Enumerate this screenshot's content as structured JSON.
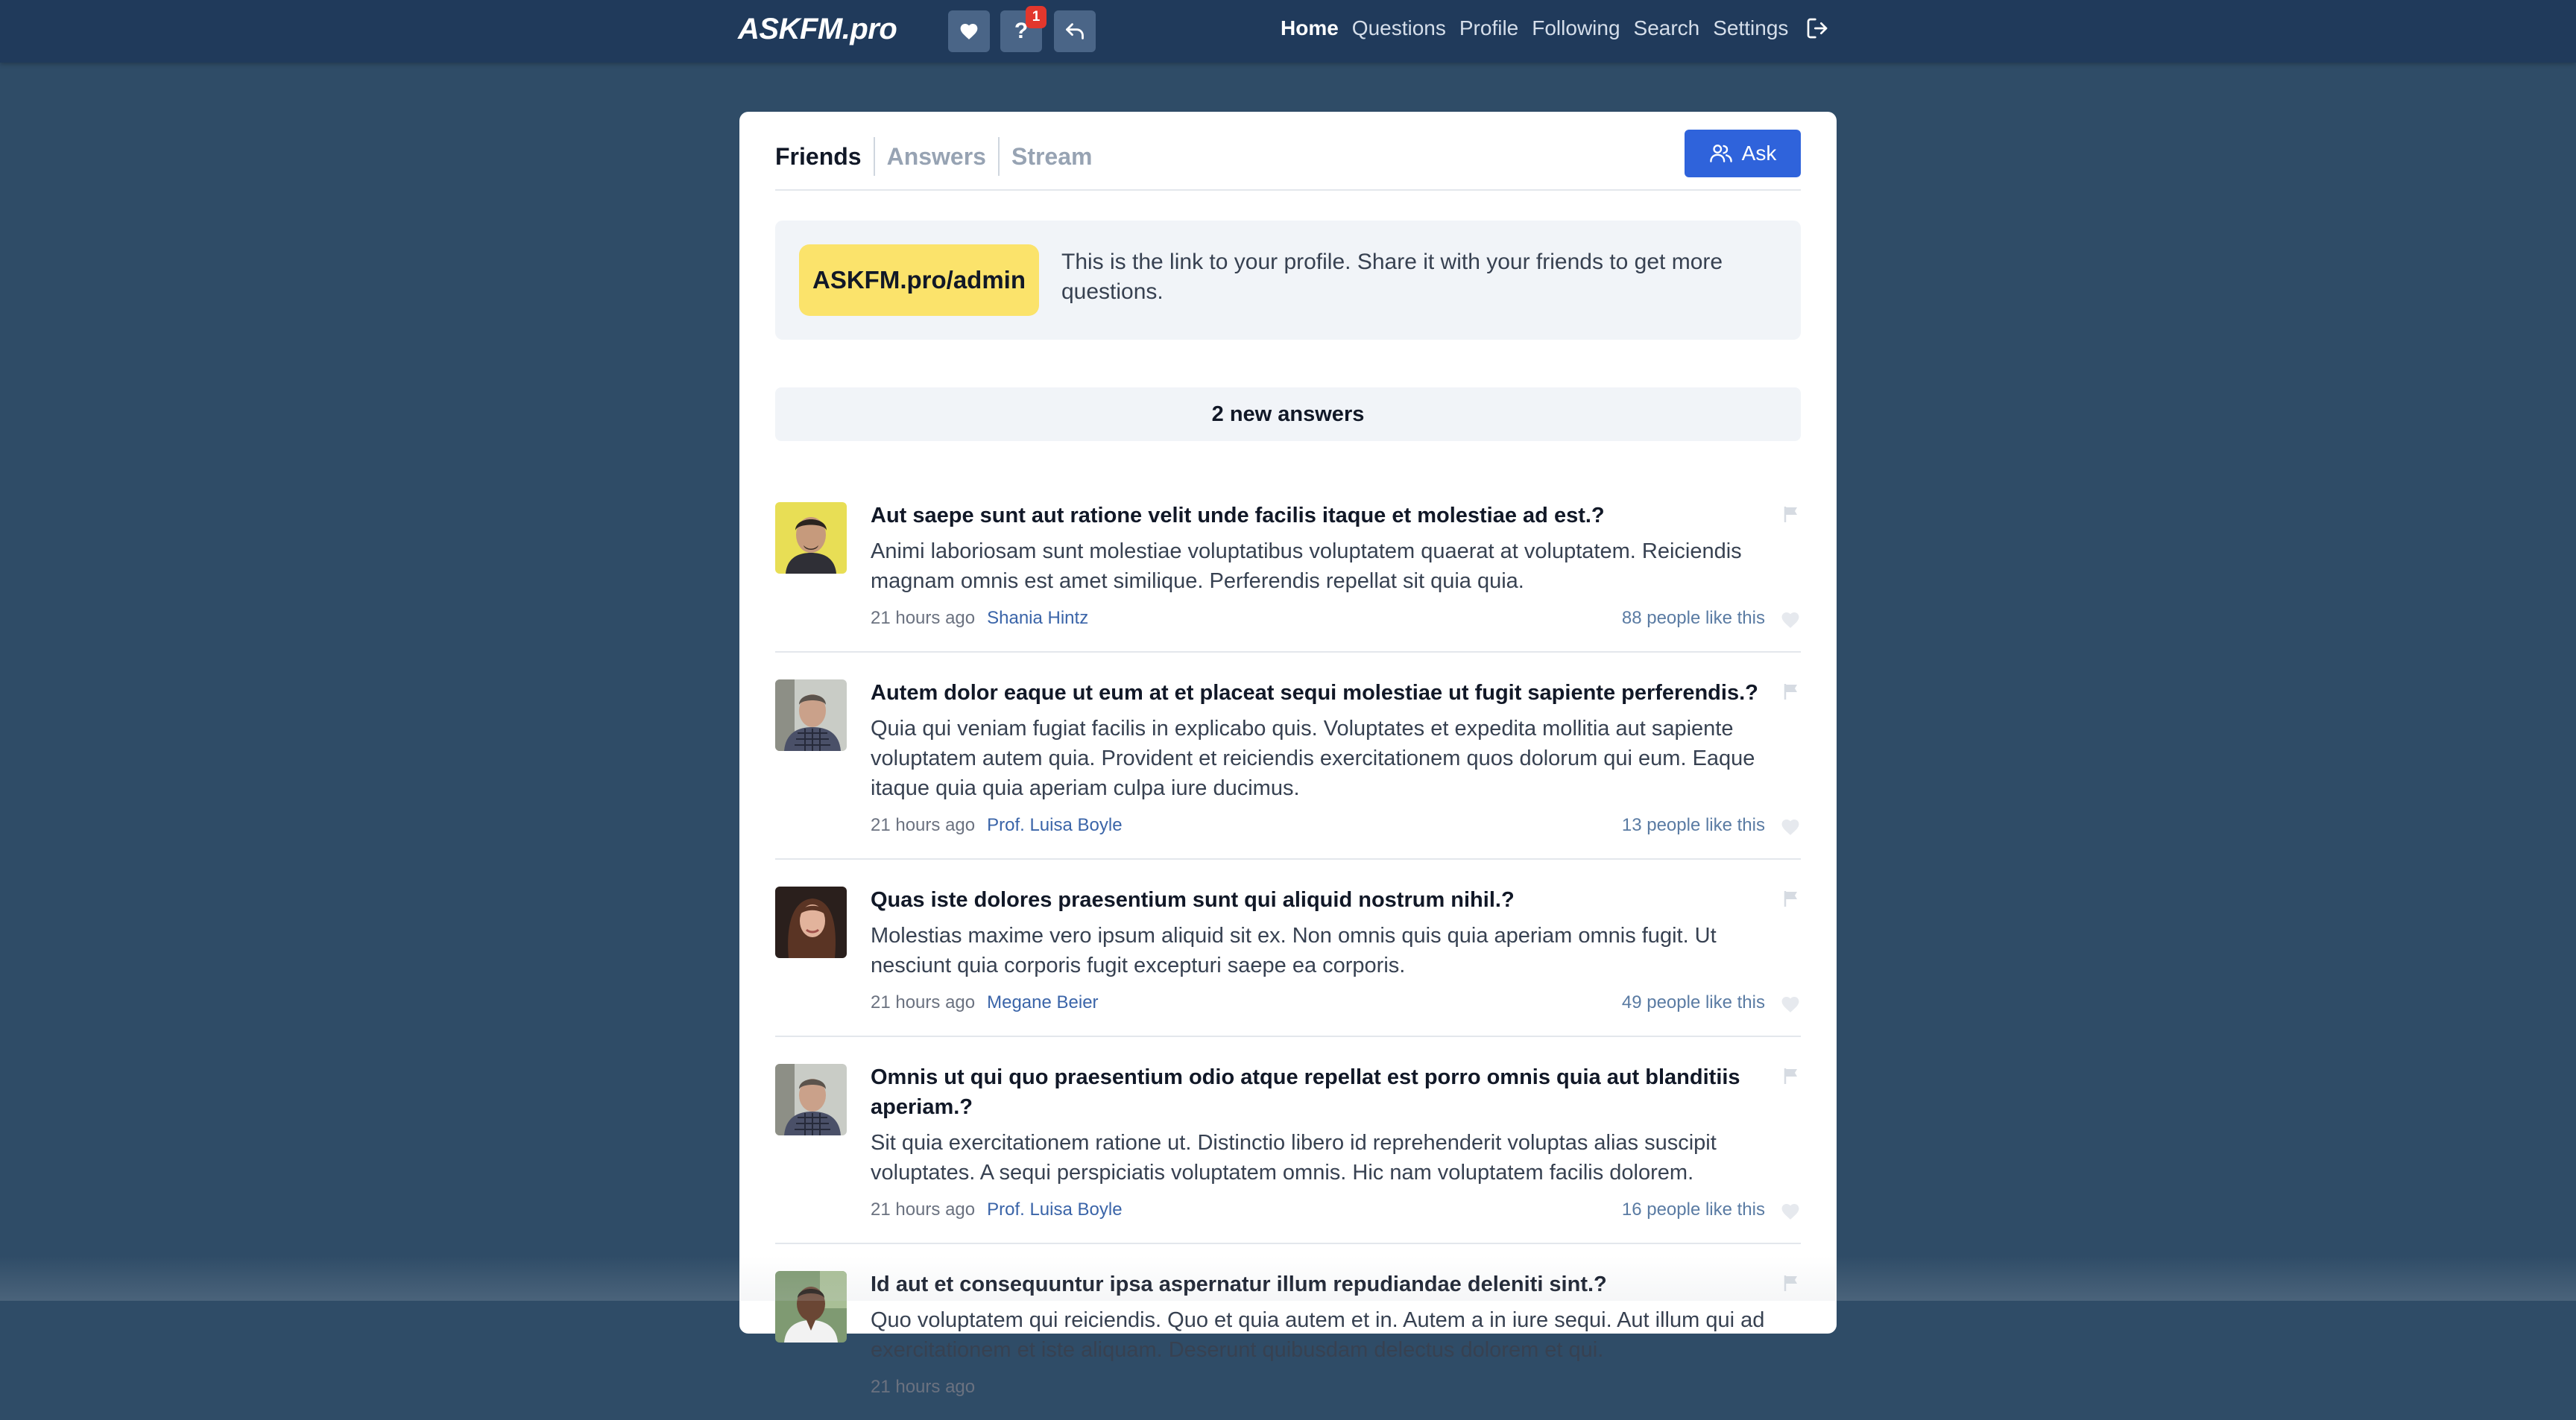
{
  "navbar": {
    "brand": "ASKFM.pro",
    "icons": [
      {
        "name": "heart-icon"
      },
      {
        "name": "question-icon",
        "label": "?",
        "badge": "1"
      },
      {
        "name": "reply-icon"
      }
    ],
    "links": [
      {
        "label": "Home",
        "active": true
      },
      {
        "label": "Questions",
        "active": false
      },
      {
        "label": "Profile",
        "active": false
      },
      {
        "label": "Following",
        "active": false
      },
      {
        "label": "Search",
        "active": false
      },
      {
        "label": "Settings",
        "active": false
      }
    ],
    "logout_icon": "logout-icon"
  },
  "tabs": [
    "Friends",
    "Answers",
    "Stream"
  ],
  "ask_button": {
    "label": "Ask",
    "icon": "users-icon"
  },
  "profile_box": {
    "link": "ASKFM.pro/admin",
    "text": "This is the link to your profile. Share it with your friends to get more questions."
  },
  "new_answers": "2 new answers",
  "answers": [
    {
      "question": "Aut saepe sunt aut ratione velit unde facilis itaque et molestiae ad est.?",
      "answer": "Animi laboriosam sunt molestiae voluptatibus voluptatem quaerat at voluptatem. Reiciendis magnam omnis est amet similique. Perferendis repellat sit quia quia.",
      "time": "21 hours ago",
      "author": "Shania Hintz",
      "likes": "88 people like this"
    },
    {
      "question": "Autem dolor eaque ut eum at et placeat sequi molestiae ut fugit sapiente perferendis.?",
      "answer": "Quia qui veniam fugiat facilis in explicabo quis. Voluptates et expedita mollitia aut sapiente voluptatem autem quia. Provident et reiciendis exercitationem quos dolorum qui eum. Eaque itaque quia quia aperiam culpa iure ducimus.",
      "time": "21 hours ago",
      "author": "Prof. Luisa Boyle",
      "likes": "13 people like this"
    },
    {
      "question": "Quas iste dolores praesentium sunt qui aliquid nostrum nihil.?",
      "answer": "Molestias maxime vero ipsum aliquid sit ex. Non omnis quis quia aperiam omnis fugit. Ut nesciunt quia corporis fugit excepturi saepe ea corporis.",
      "time": "21 hours ago",
      "author": "Megane Beier",
      "likes": "49 people like this"
    },
    {
      "question": "Omnis ut qui quo praesentium odio atque repellat est porro omnis quia aut blanditiis aperiam.?",
      "answer": "Sit quia exercitationem ratione ut. Distinctio libero id reprehenderit voluptas alias suscipit voluptates. A sequi perspiciatis voluptatem omnis. Hic nam voluptatem facilis dolorem.",
      "time": "21 hours ago",
      "author": "Prof. Luisa Boyle",
      "likes": "16 people like this"
    },
    {
      "question": "Id aut et consequuntur ipsa aspernatur illum repudiandae deleniti sint.?",
      "answer": "Quo voluptatem qui reiciendis. Quo et quia autem et in. Autem a in iure sequi. Aut illum qui ad exercitationem et iste aliquam. Deserunt quibusdam delectus dolorem et qui.",
      "time": "21 hours ago",
      "author": "",
      "likes": ""
    }
  ],
  "colors": {
    "page_bg": "#2f4c67",
    "navbar_bg": "#203a5b",
    "accent": "#2f63db",
    "profile_link_bg": "#fbe36b",
    "author_link": "#3a64a8",
    "badge": "#e2372d"
  }
}
